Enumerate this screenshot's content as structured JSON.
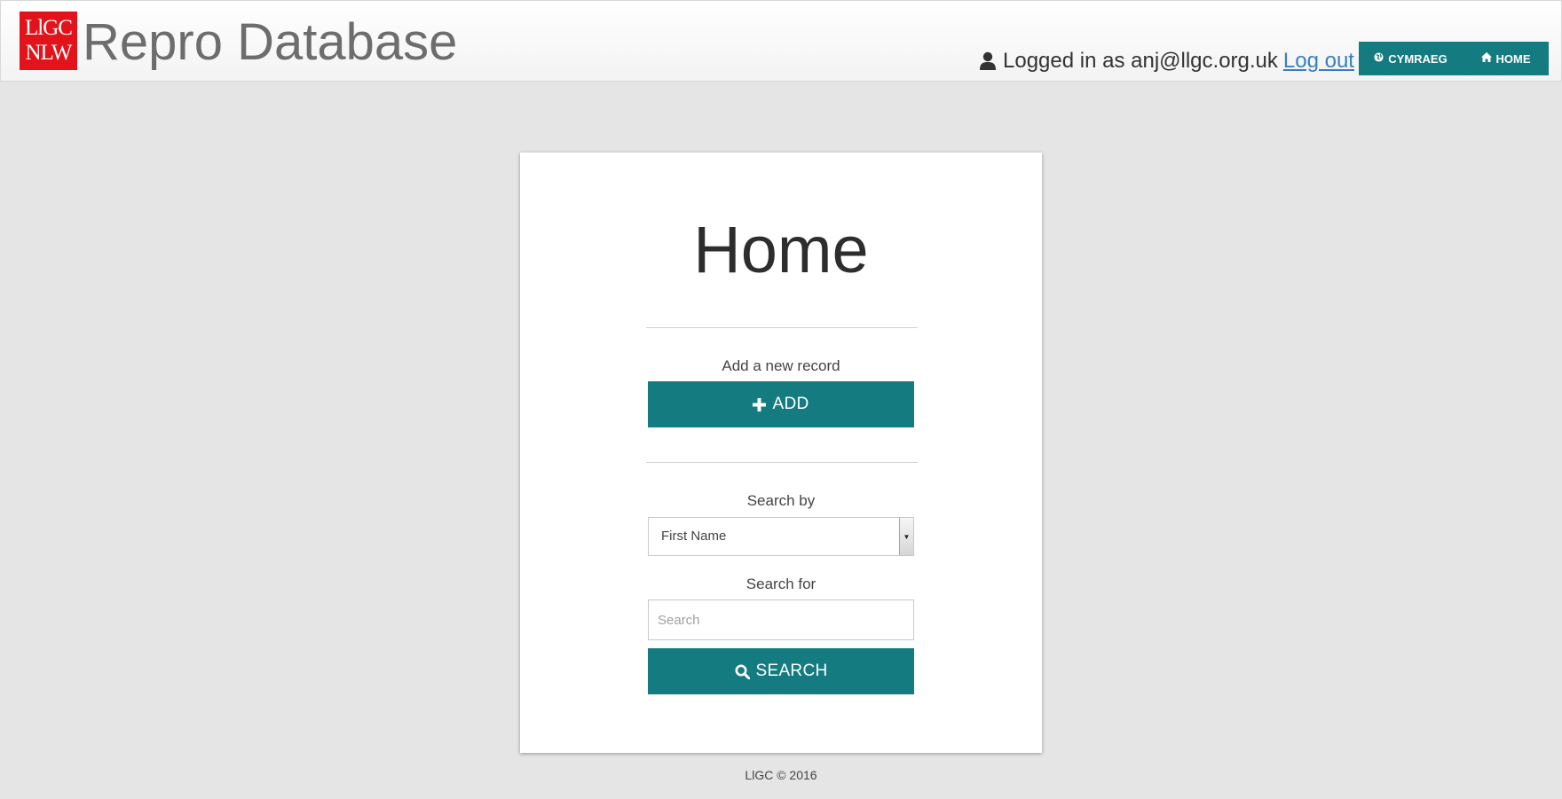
{
  "header": {
    "logo_line1": "LlGC",
    "logo_line2": "NLW",
    "app_title": "Repro Database",
    "logged_in_text": "Logged in as anj@llgc.org.uk",
    "logout_label": "Log out",
    "language_button_label": "CYMRAEG",
    "home_button_label": "HOME",
    "icons": {
      "user": "user-icon",
      "language": "globe-icon",
      "home": "home-icon"
    }
  },
  "main": {
    "page_title": "Home",
    "add_section": {
      "label": "Add a new record",
      "button_label": "ADD",
      "button_icon": "plus-icon"
    },
    "search_section": {
      "search_by_label": "Search by",
      "search_by_selected": "First Name",
      "search_for_label": "Search for",
      "search_placeholder": "Search",
      "search_value": "",
      "button_label": "SEARCH",
      "button_icon": "search-icon"
    }
  },
  "footer": {
    "text": "LlGC © 2016"
  },
  "colors": {
    "accent": "#147c80",
    "logo_red": "#e2131a",
    "link": "#3a7ec2",
    "background": "#e5e5e5"
  }
}
